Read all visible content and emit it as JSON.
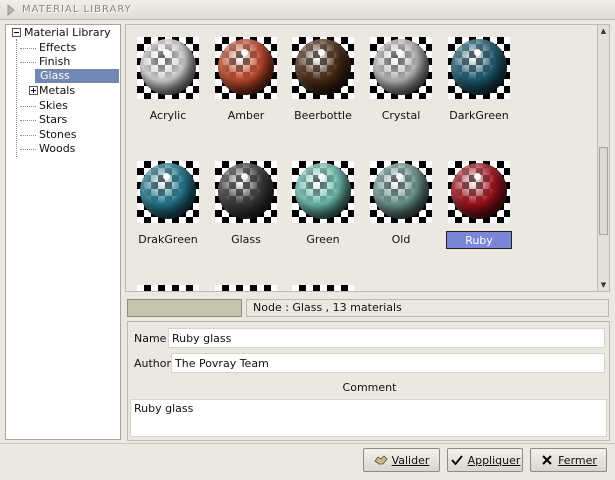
{
  "window": {
    "title": "MATERIAL LIBRARY"
  },
  "tree": {
    "root": "Material Library",
    "items": [
      {
        "label": "Effects",
        "selected": false,
        "expandable": false
      },
      {
        "label": "Finish",
        "selected": false,
        "expandable": false
      },
      {
        "label": "Glass",
        "selected": true,
        "expandable": false
      },
      {
        "label": "Metals",
        "selected": false,
        "expandable": true
      },
      {
        "label": "Skies",
        "selected": false,
        "expandable": false
      },
      {
        "label": "Stars",
        "selected": false,
        "expandable": false
      },
      {
        "label": "Stones",
        "selected": false,
        "expandable": false
      },
      {
        "label": "Woods",
        "selected": false,
        "expandable": false
      }
    ]
  },
  "materials": [
    {
      "name": "Acrylic",
      "color": "#d8d8d8",
      "selected": false
    },
    {
      "name": "Amber",
      "color": "#c2482a",
      "selected": false
    },
    {
      "name": "Beerbottle",
      "color": "#4a2a14",
      "selected": false
    },
    {
      "name": "Crystal",
      "color": "#bdbdbd",
      "selected": false
    },
    {
      "name": "DarkGreen",
      "color": "#1d5b72",
      "selected": false
    },
    {
      "name": "DrakGreen",
      "color": "#247a92",
      "selected": false
    },
    {
      "name": "Glass",
      "color": "#3a3a3a",
      "selected": false
    },
    {
      "name": "Green",
      "color": "#6fc2b4",
      "selected": false
    },
    {
      "name": "Old",
      "color": "#6f9a92",
      "selected": false
    },
    {
      "name": "Ruby",
      "color": "#a4101c",
      "selected": true
    }
  ],
  "status": {
    "node": "Node : Glass , 13 materials"
  },
  "details": {
    "name_label": "Name",
    "name_value": "Ruby glass",
    "author_label": "Author",
    "author_value": "The Povray Team",
    "comment_label": "Comment",
    "comment_value": "Ruby glass"
  },
  "buttons": {
    "validate": "Valider",
    "apply": "Appliquer",
    "close": "Fermer"
  },
  "colors": {
    "selection": "#7387b3",
    "selected_tile": "#7b86d8"
  }
}
